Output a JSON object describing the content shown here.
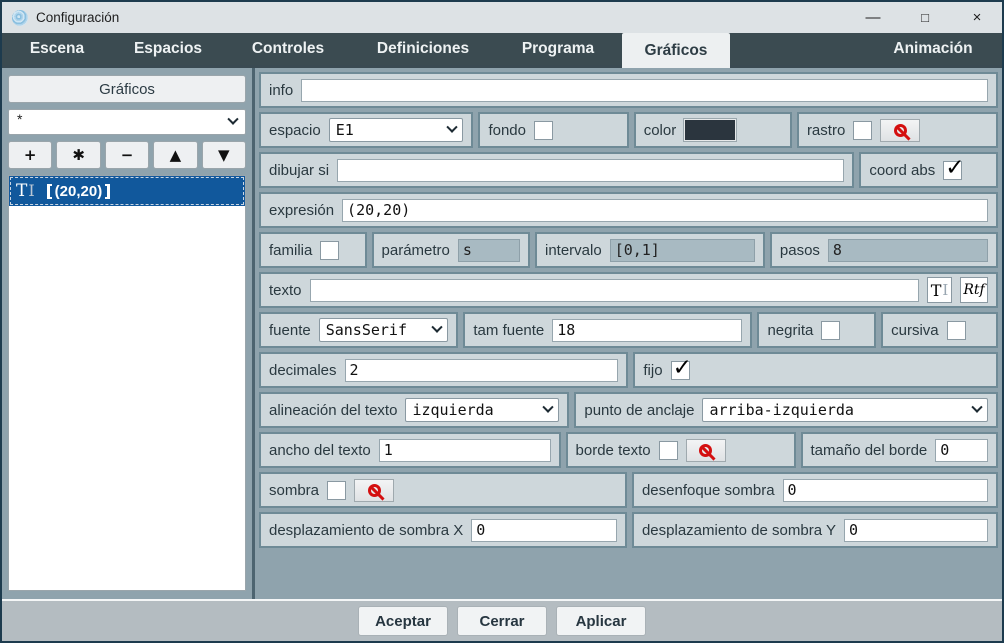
{
  "window": {
    "title": "Configuración",
    "controls": {
      "minimize": "—",
      "maximize": "□",
      "close": "×"
    }
  },
  "tabs": [
    {
      "label": "Escena",
      "active": false
    },
    {
      "label": "Espacios",
      "active": false
    },
    {
      "label": "Controles",
      "active": false
    },
    {
      "label": "Definiciones",
      "active": false
    },
    {
      "label": "Programa",
      "active": false
    },
    {
      "label": "Gráficos",
      "active": true
    },
    {
      "label": "Animación",
      "active": false
    }
  ],
  "sidebar": {
    "header": "Gráficos",
    "filter": {
      "value": "*"
    },
    "toolbar": {
      "add": "+",
      "duplicate": "✱",
      "remove": "−",
      "move_up": "▲",
      "move_down": "▼"
    },
    "list": {
      "items": [
        {
          "type": "text-graphic",
          "icon_text": "T",
          "icon_beam": "I",
          "label": "(20,20)",
          "display": "【(20,20)】",
          "selected": true
        }
      ]
    }
  },
  "form": {
    "info": {
      "label": "info",
      "value": ""
    },
    "espacio": {
      "label": "espacio",
      "value": "E1"
    },
    "fondo": {
      "label": "fondo",
      "checked": false
    },
    "color": {
      "label": "color",
      "swatch": "#2b353e"
    },
    "rastro": {
      "label": "rastro",
      "checked": false
    },
    "dibujar_si": {
      "label": "dibujar si",
      "value": ""
    },
    "coord_abs": {
      "label": "coord abs",
      "checked": true
    },
    "expresion": {
      "label": "expresión",
      "value": "(20,20)"
    },
    "familia": {
      "label": "familia",
      "checked": false
    },
    "parametro": {
      "label": "parámetro",
      "value": "s",
      "disabled": true
    },
    "intervalo": {
      "label": "intervalo",
      "value": "[0,1]",
      "disabled": true
    },
    "pasos": {
      "label": "pasos",
      "value": "8",
      "disabled": true
    },
    "texto": {
      "label": "texto",
      "value": "",
      "plain_button": "T",
      "rtf_button": "Rtf"
    },
    "fuente": {
      "label": "fuente",
      "value": "SansSerif"
    },
    "tam_fuente": {
      "label": "tam fuente",
      "value": "18"
    },
    "negrita": {
      "label": "negrita",
      "checked": false
    },
    "cursiva": {
      "label": "cursiva",
      "checked": false
    },
    "decimales": {
      "label": "decimales",
      "value": "2"
    },
    "fijo": {
      "label": "fijo",
      "checked": true
    },
    "alineacion": {
      "label": "alineación del texto",
      "value": "izquierda"
    },
    "anclaje": {
      "label": "punto de anclaje",
      "value": "arriba-izquierda"
    },
    "ancho_texto": {
      "label": "ancho del texto",
      "value": "1"
    },
    "borde_texto": {
      "label": "borde texto",
      "checked": false
    },
    "tamano_borde": {
      "label": "tamaño del borde",
      "value": "0"
    },
    "sombra": {
      "label": "sombra",
      "checked": false
    },
    "desenfoque": {
      "label": "desenfoque sombra",
      "value": "0"
    },
    "desp_x": {
      "label": "desplazamiento de sombra X",
      "value": "0"
    },
    "desp_y": {
      "label": "desplazamiento de sombra Y",
      "value": "0"
    }
  },
  "footer": {
    "accept": "Aceptar",
    "close": "Cerrar",
    "apply": "Aplicar"
  },
  "colors": {
    "selection_blue": "#11589c",
    "prohibit_red": "#d40f0f",
    "color_swatch": "#2b353e",
    "panel_background": "#8fa3ad",
    "tabbar_background": "#3b4b51"
  }
}
